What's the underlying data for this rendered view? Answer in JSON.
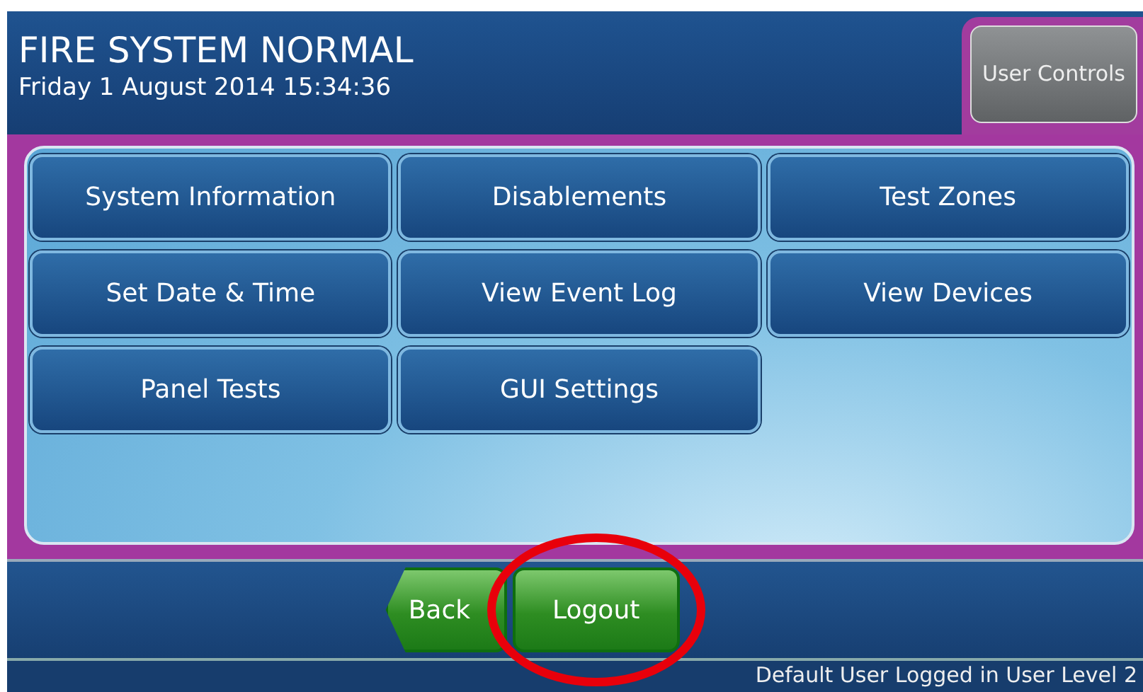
{
  "header": {
    "title": "FIRE SYSTEM NORMAL",
    "datetime": "Friday 1 August 2014 15:34:36",
    "tab_button": {
      "label": "User Controls",
      "selected": true
    }
  },
  "menu_buttons": [
    {
      "label": "System Information"
    },
    {
      "label": "Disablements"
    },
    {
      "label": "Test Zones"
    },
    {
      "label": "Set Date & Time"
    },
    {
      "label": "View Event Log"
    },
    {
      "label": "View Devices"
    },
    {
      "label": "Panel Tests"
    },
    {
      "label": "GUI Settings"
    }
  ],
  "nav_buttons": [
    {
      "label": "Back",
      "kind": "back"
    },
    {
      "label": "Logout",
      "kind": "plain",
      "highlighted": true
    }
  ],
  "status_bar": "Default User Logged in User Level 2"
}
